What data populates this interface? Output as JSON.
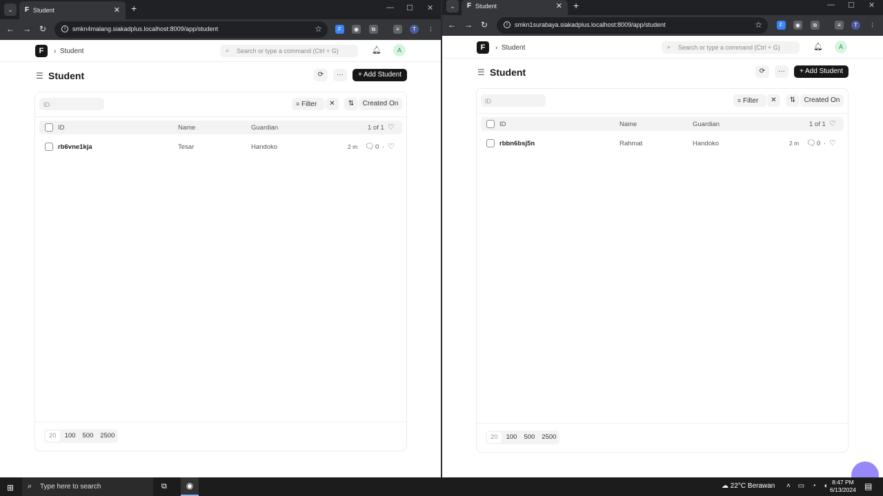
{
  "windows": [
    {
      "tab_title": "Student",
      "url": "smkn4malang.siakadplus.localhost:8009/app/student",
      "breadcrumb": "Student",
      "search_placeholder": "Search or type a command (Ctrl + G)",
      "avatar": "A",
      "page_title": "Student",
      "add_button": "+ Add Student",
      "id_filter_placeholder": "ID",
      "filter_label": "Filter",
      "sort_label": "Created On",
      "columns": [
        "ID",
        "Name",
        "Guardian"
      ],
      "count": "1 of 1",
      "rows": [
        {
          "id": "rb6vne1kja",
          "name": "Tesar",
          "guardian": "Handoko",
          "modified": "2 m",
          "comments": "0"
        }
      ],
      "page_sizes": [
        "20",
        "100",
        "500",
        "2500"
      ]
    },
    {
      "tab_title": "Student",
      "url": "smkn1surabaya.siakadplus.localhost:8009/app/student",
      "breadcrumb": "Student",
      "search_placeholder": "Search or type a command (Ctrl + G)",
      "avatar": "A",
      "page_title": "Student",
      "add_button": "+ Add Student",
      "id_filter_placeholder": "ID",
      "filter_label": "Filter",
      "sort_label": "Created On",
      "columns": [
        "ID",
        "Name",
        "Guardian"
      ],
      "count": "1 of 1",
      "rows": [
        {
          "id": "rbbn6bsj5n",
          "name": "Rahmat",
          "guardian": "Handoko",
          "modified": "2 m",
          "comments": "0"
        }
      ],
      "page_sizes": [
        "20",
        "100",
        "500",
        "2500"
      ]
    }
  ],
  "taskbar": {
    "search_text": "Type here to search",
    "weather": "22°C  Berawan",
    "time": "8:47 PM",
    "date": "6/13/2024"
  }
}
